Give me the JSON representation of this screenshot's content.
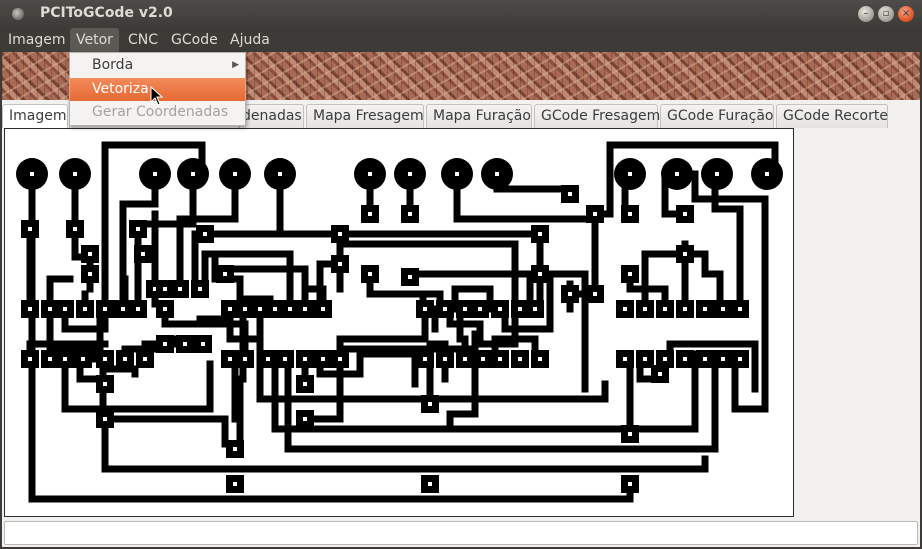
{
  "window": {
    "title": "PCIToGCode  v2.0"
  },
  "menubar": {
    "items": [
      "Imagem",
      "Vetor",
      "CNC",
      "GCode",
      "Ajuda"
    ],
    "open": "Vetor"
  },
  "dropdown": {
    "items": [
      {
        "label": "Borda",
        "state": "normal",
        "submenu": true
      },
      {
        "label": "Vetoriza",
        "state": "highlighted",
        "submenu": false
      },
      {
        "label": "Gerar Coordenadas",
        "state": "disabled",
        "submenu": false
      }
    ]
  },
  "tabs": [
    "Imagem",
    "",
    "denadas",
    "Mapa Fresagem",
    "Mapa Furação",
    "GCode Fresagem",
    "GCode Furação",
    "GCode Recorte"
  ],
  "status": {
    "text": ""
  },
  "colors": {
    "accent": "#e9662f",
    "titlebar": "#3c3b37",
    "trace": "#000000"
  }
}
